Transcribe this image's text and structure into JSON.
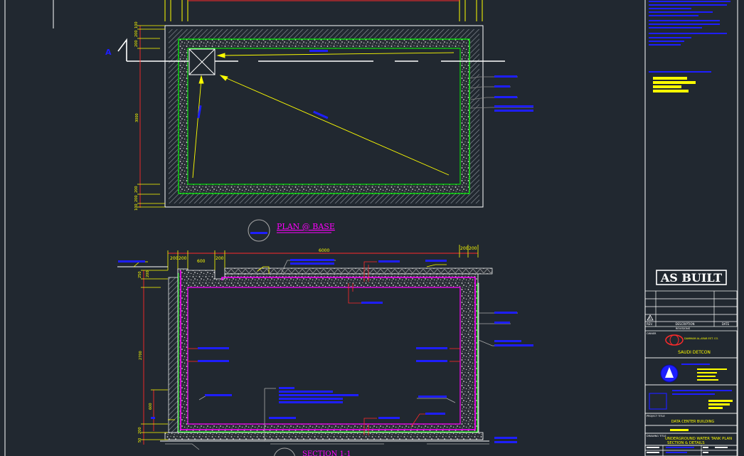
{
  "drawing": {
    "plan_title": "PLAN @ BASE",
    "section_title": "SECTION 1-1",
    "section_marker": "A",
    "stamp": "AS BUILT"
  },
  "dimensions": {
    "plan_top_offsets": [
      "100",
      "200",
      "200"
    ],
    "plan_bottom_offsets": [
      "200",
      "200",
      "100"
    ],
    "plan_height": "3000",
    "section_width": "6000",
    "section_left_offsets": [
      "200",
      "200",
      "600",
      "200"
    ],
    "section_right_offsets": [
      "200",
      "200"
    ],
    "section_height": "2700",
    "section_top_left": [
      "250",
      "200"
    ],
    "section_lower_left": "600",
    "section_base_left": [
      "200",
      "50"
    ]
  },
  "title_block": {
    "revision_marker": "A",
    "rev_header": "REV.",
    "description_header": "DESCRIPTION",
    "date_header": "DATE",
    "revisions_caption": "REVISIONS",
    "client_caption": "OWNER",
    "client_brand_name": "DAMMAM AL-ARAB EST. CO.",
    "client_name": "SAUDI DETCON",
    "project_label": "PROJECT TITLE",
    "project_name": "DATA CENTER BUILDING",
    "drawing_title_label": "DRAWING TITLE",
    "drawing_title_line1": "UNDERGROUND  WATER TANK PLAN",
    "drawing_title_line2": "SECTION  & DETAILS"
  },
  "colors": {
    "background": "#212830",
    "wall_hatch": "#8a9099",
    "concrete": "#c8c8c8",
    "membrane_green": "#00ff00",
    "membrane_magenta": "#ff00ff",
    "dimension_red": "#ff2a2a",
    "note_blue": "#1e1eff",
    "leader_yellow": "#ffff00",
    "frame_white": "#ffffff"
  }
}
